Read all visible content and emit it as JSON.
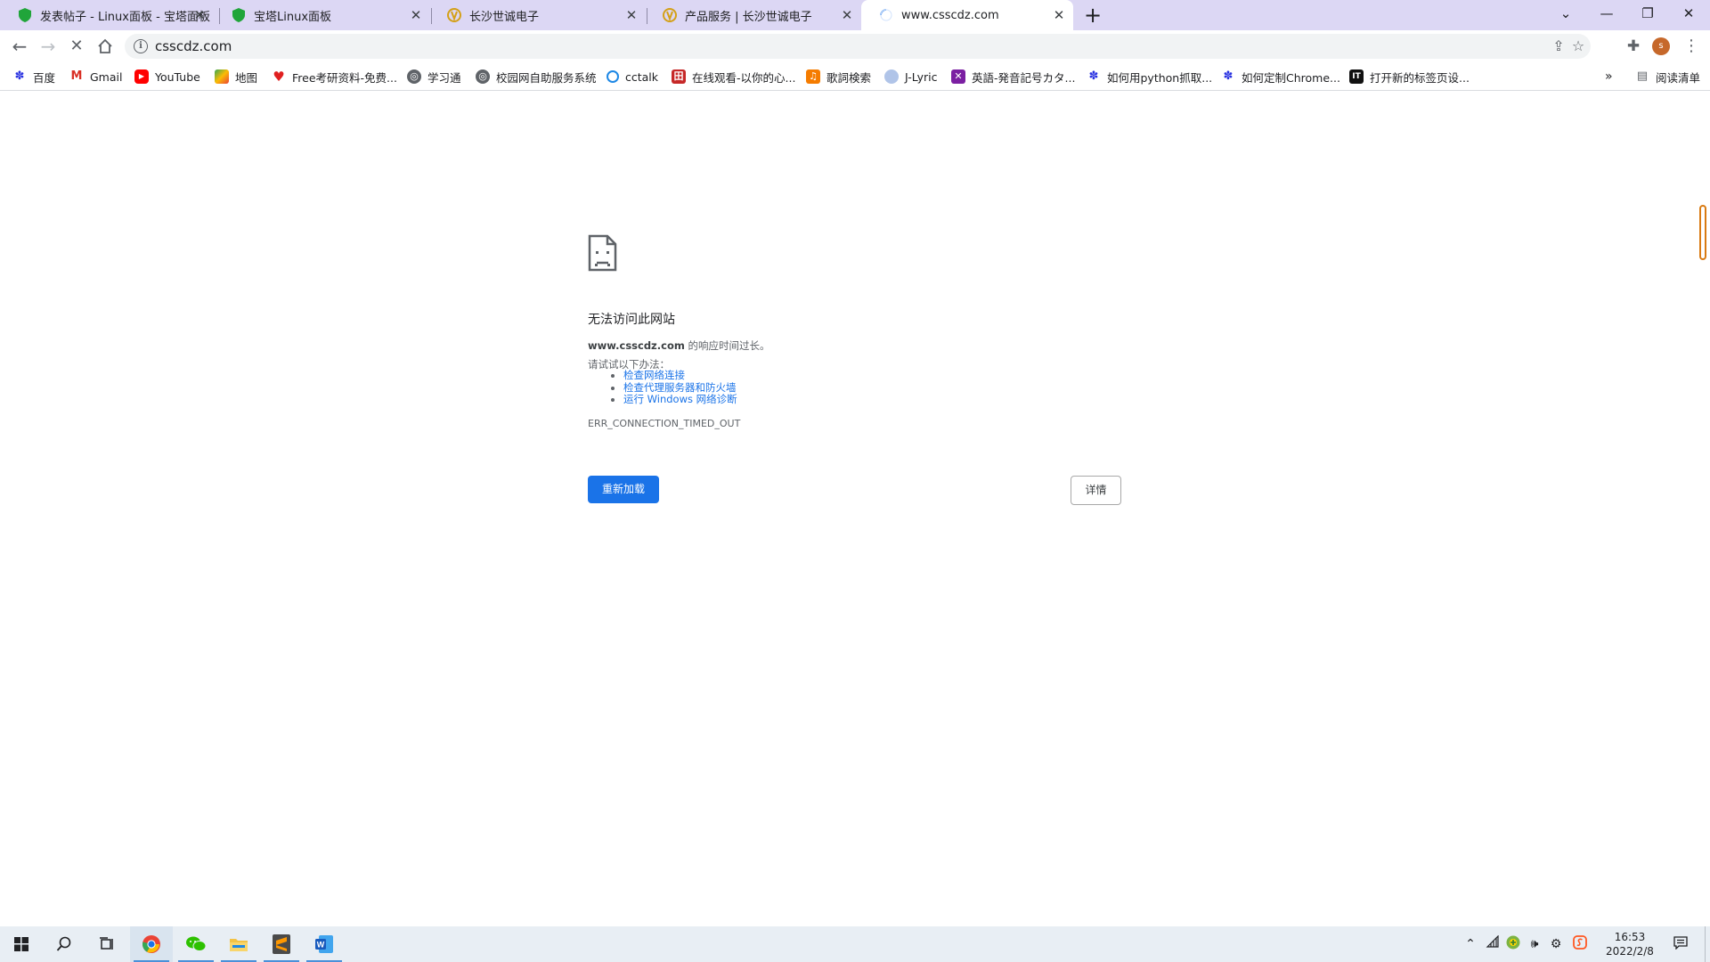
{
  "tabs": [
    {
      "title": "发表帖子 - Linux面板 - 宝塔面板",
      "favicon": "shield-green"
    },
    {
      "title": "宝塔Linux面板",
      "favicon": "shield-green"
    },
    {
      "title": "长沙世诚电子",
      "favicon": "logo-yellow"
    },
    {
      "title": "产品服务 | 长沙世诚电子",
      "favicon": "logo-yellow"
    },
    {
      "title": "www.csscdz.com",
      "favicon": "loading-spinner"
    }
  ],
  "address_bar": {
    "url": "csscdz.com"
  },
  "bookmarks": [
    {
      "label": "百度",
      "icon": "paw-icon",
      "color": "#2932e1"
    },
    {
      "label": "Gmail",
      "icon": "gmail-icon",
      "color": "#d93025"
    },
    {
      "label": "YouTube",
      "icon": "youtube-icon",
      "color": "#ff0000"
    },
    {
      "label": "地图",
      "icon": "maps-icon",
      "color": "#34a853"
    },
    {
      "label": "Free考研资料-免费...",
      "icon": "heart-icon",
      "color": "#e02020"
    },
    {
      "label": "学习通",
      "icon": "globe-icon",
      "color": "#5f6368"
    },
    {
      "label": "校园网自助服务系统",
      "icon": "globe-icon",
      "color": "#5f6368"
    },
    {
      "label": "cctalk",
      "icon": "cctalk-icon",
      "color": "#1e88e5"
    },
    {
      "label": "在线观看-以你的心...",
      "icon": "red-square-icon",
      "color": "#c62828"
    },
    {
      "label": "歌詞検索",
      "icon": "music-icon",
      "color": "#f57c00"
    },
    {
      "label": "J-Lyric",
      "icon": "jlyric-icon",
      "color": "#7aa0d8"
    },
    {
      "label": "英語-発音記号カタ...",
      "icon": "flag-icon",
      "color": "#7b1fa2"
    },
    {
      "label": "如何用python抓取...",
      "icon": "paw-icon",
      "color": "#2932e1"
    },
    {
      "label": "如何定制Chrome...",
      "icon": "paw-icon",
      "color": "#2932e1"
    },
    {
      "label": "打开新的标签页设...",
      "icon": "it-icon",
      "color": "#111111"
    }
  ],
  "reading_list": "阅读清单",
  "error": {
    "title": "无法访问此网站",
    "host": "www.csscdz.com",
    "desc_suffix": " 的响应时间过长。",
    "try_label": "请试试以下办法：",
    "suggestions": [
      "检查网络连接",
      "检查代理服务器和防火墙",
      "运行 Windows 网络诊断"
    ],
    "code": "ERR_CONNECTION_TIMED_OUT",
    "reload_label": "重新加载",
    "details_label": "详情"
  },
  "profile_initial": "s",
  "taskbar": {
    "clock_time": "16:53",
    "clock_date": "2022/2/8",
    "accent": "#4a90d9"
  }
}
